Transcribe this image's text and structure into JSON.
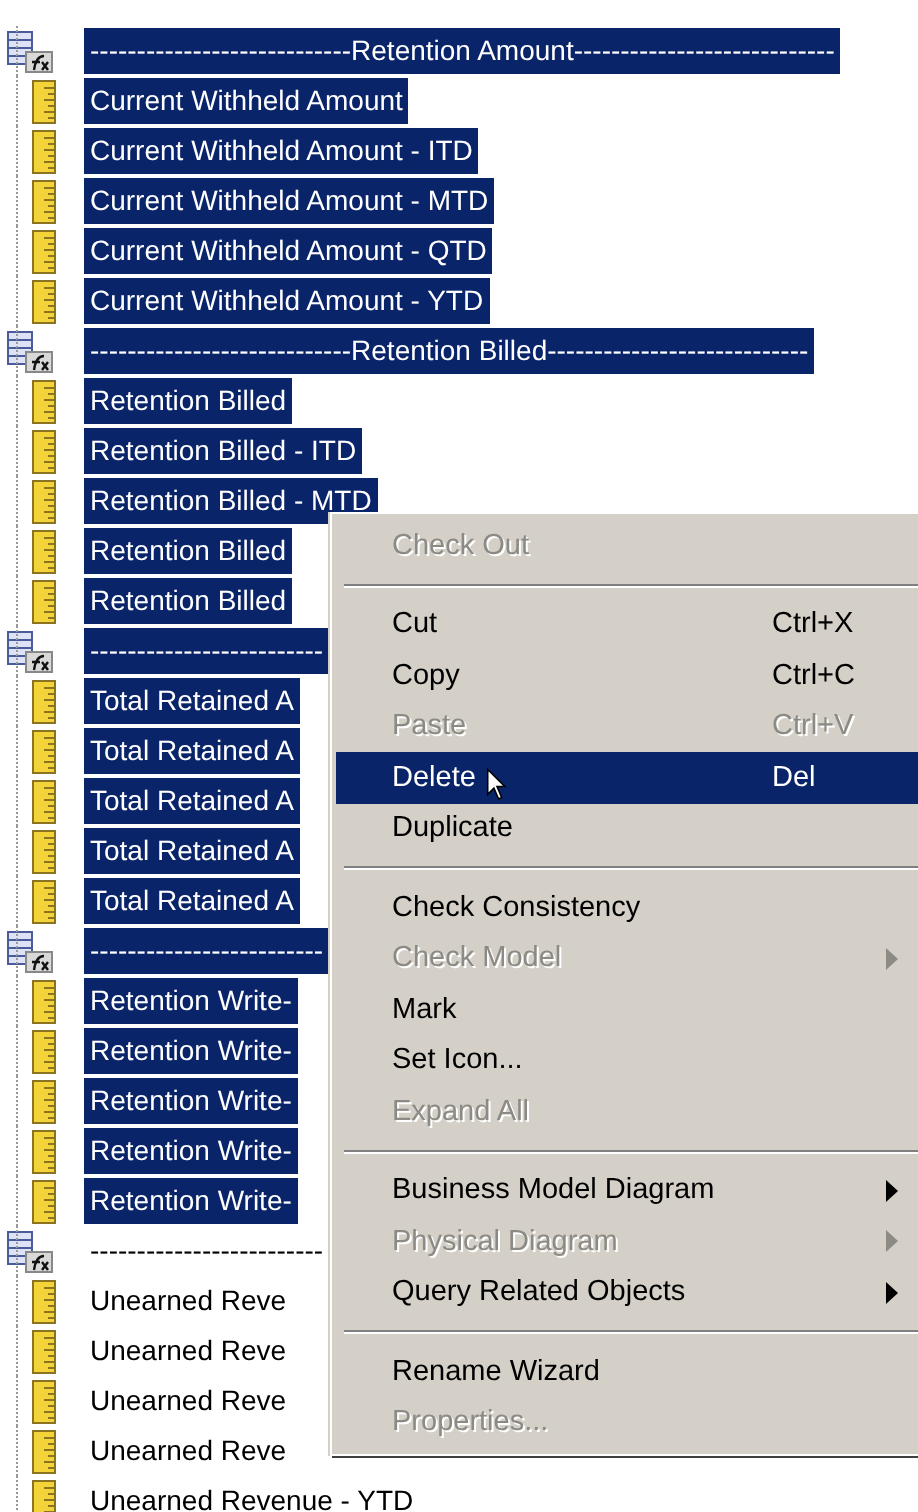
{
  "tree": {
    "rows": [
      {
        "kind": "header",
        "text": "----------------------------Retention Amount----------------------------",
        "selected": true
      },
      {
        "kind": "measure",
        "text": "Current Withheld Amount",
        "selected": true
      },
      {
        "kind": "measure",
        "text": "Current Withheld Amount - ITD",
        "selected": true
      },
      {
        "kind": "measure",
        "text": "Current Withheld Amount - MTD",
        "selected": true
      },
      {
        "kind": "measure",
        "text": "Current Withheld Amount - QTD",
        "selected": true
      },
      {
        "kind": "measure",
        "text": "Current Withheld Amount - YTD",
        "selected": true
      },
      {
        "kind": "header",
        "text": "----------------------------Retention Billed----------------------------",
        "selected": true
      },
      {
        "kind": "measure",
        "text": "Retention Billed",
        "selected": true
      },
      {
        "kind": "measure",
        "text": "Retention Billed - ITD",
        "selected": true
      },
      {
        "kind": "measure",
        "text": "Retention Billed - MTD",
        "selected": true
      },
      {
        "kind": "measure",
        "text": "Retention Billed",
        "selected": true
      },
      {
        "kind": "measure",
        "text": "Retention Billed",
        "selected": true
      },
      {
        "kind": "header",
        "text": "-------------------------",
        "selected": true
      },
      {
        "kind": "measure",
        "text": "Total Retained A",
        "selected": true
      },
      {
        "kind": "measure",
        "text": "Total Retained A",
        "selected": true
      },
      {
        "kind": "measure",
        "text": "Total Retained A",
        "selected": true
      },
      {
        "kind": "measure",
        "text": "Total Retained A",
        "selected": true
      },
      {
        "kind": "measure",
        "text": "Total Retained A",
        "selected": true
      },
      {
        "kind": "header",
        "text": "-------------------------",
        "selected": true
      },
      {
        "kind": "measure",
        "text": "Retention Write-",
        "selected": true
      },
      {
        "kind": "measure",
        "text": "Retention Write-",
        "selected": true
      },
      {
        "kind": "measure",
        "text": "Retention Write-",
        "selected": true
      },
      {
        "kind": "measure",
        "text": "Retention Write-",
        "selected": true
      },
      {
        "kind": "measure",
        "text": "Retention Write-",
        "selected": true
      },
      {
        "kind": "header",
        "text": "-------------------------",
        "selected": false
      },
      {
        "kind": "measure",
        "text": "Unearned Reve",
        "selected": false
      },
      {
        "kind": "measure",
        "text": "Unearned Reve",
        "selected": false
      },
      {
        "kind": "measure",
        "text": "Unearned Reve",
        "selected": false
      },
      {
        "kind": "measure",
        "text": "Unearned Reve",
        "selected": false
      },
      {
        "kind": "measure",
        "text": "Unearned Revenue - YTD",
        "selected": false
      }
    ]
  },
  "context_menu": {
    "items": [
      {
        "kind": "item",
        "label": "Check Out",
        "disabled": true,
        "submenu": false,
        "selected": false
      },
      {
        "kind": "separator"
      },
      {
        "kind": "item",
        "label": "Cut",
        "shortcut": "Ctrl+X",
        "disabled": false,
        "submenu": false,
        "selected": false
      },
      {
        "kind": "item",
        "label": "Copy",
        "shortcut": "Ctrl+C",
        "disabled": false,
        "submenu": false,
        "selected": false
      },
      {
        "kind": "item",
        "label": "Paste",
        "shortcut": "Ctrl+V",
        "disabled": true,
        "submenu": false,
        "selected": false
      },
      {
        "kind": "item",
        "label": "Delete",
        "shortcut": "Del",
        "disabled": false,
        "submenu": false,
        "selected": true
      },
      {
        "kind": "item",
        "label": "Duplicate",
        "disabled": false,
        "submenu": false,
        "selected": false
      },
      {
        "kind": "separator"
      },
      {
        "kind": "item",
        "label": "Check Consistency",
        "disabled": false,
        "submenu": false,
        "selected": false
      },
      {
        "kind": "item",
        "label": "Check Model",
        "disabled": true,
        "submenu": true,
        "selected": false
      },
      {
        "kind": "item",
        "label": "Mark",
        "disabled": false,
        "submenu": false,
        "selected": false
      },
      {
        "kind": "item",
        "label": "Set Icon...",
        "disabled": false,
        "submenu": false,
        "selected": false
      },
      {
        "kind": "item",
        "label": "Expand All",
        "disabled": true,
        "submenu": false,
        "selected": false
      },
      {
        "kind": "separator"
      },
      {
        "kind": "item",
        "label": "Business Model Diagram",
        "disabled": false,
        "submenu": true,
        "selected": false
      },
      {
        "kind": "item",
        "label": "Physical Diagram",
        "disabled": true,
        "submenu": true,
        "selected": false
      },
      {
        "kind": "item",
        "label": "Query Related Objects",
        "disabled": false,
        "submenu": true,
        "selected": false
      },
      {
        "kind": "separator"
      },
      {
        "kind": "item",
        "label": "Rename Wizard",
        "disabled": false,
        "submenu": false,
        "selected": false
      },
      {
        "kind": "item",
        "label": "Properties...",
        "disabled": true,
        "submenu": false,
        "selected": false
      }
    ]
  }
}
